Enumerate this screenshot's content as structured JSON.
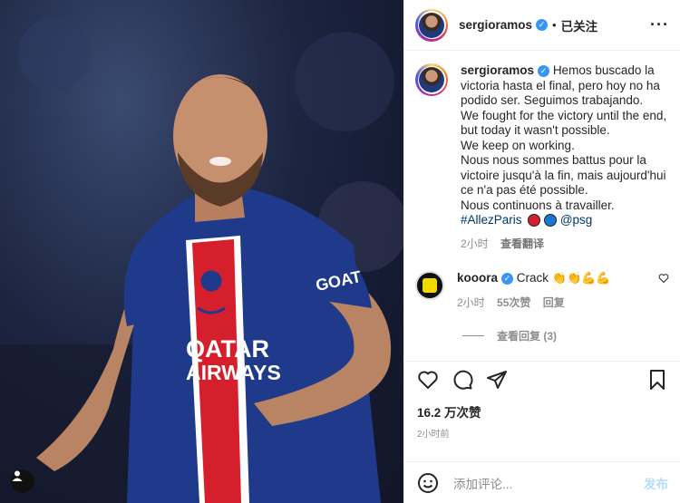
{
  "header": {
    "username": "sergioramos",
    "follow_label": "已关注",
    "more_label": "···"
  },
  "caption": {
    "username": "sergioramos",
    "lines": [
      "Hemos buscado la victoria hasta el final, pero hoy no ha podido ser. Seguimos trabajando.",
      "We fought for the victory until the end, but today it wasn't possible.",
      "We keep on working.",
      "Nous nous sommes battus pour la victoire jusqu'à la fin, mais aujourd'hui ce n'a pas été possible.",
      "Nous continuons à travailler."
    ],
    "hashtag": "#AllezParis",
    "mention": "@psg",
    "time": "2小时",
    "see_translation": "查看翻译"
  },
  "comment": {
    "username": "kooora",
    "text": "Crack",
    "time": "2小时",
    "likes": "55次赞",
    "reply_label": "回复",
    "view_replies": "查看回复 (3)"
  },
  "post_stats": {
    "likes": "16.2 万次赞",
    "time": "2小时前"
  },
  "composer": {
    "placeholder": "添加评论...",
    "post_label": "发布"
  },
  "media": {
    "shirt_text_1": "QATAR",
    "shirt_text_2": "AIRWAYS",
    "sleeve_text": "GOAT",
    "badge_text": "PSG"
  },
  "colors": {
    "verified": "#3897f0",
    "link": "#00376b",
    "muted": "#8e8e8e",
    "post_button": "#b2dffc",
    "jersey": "#1f3a8a"
  }
}
